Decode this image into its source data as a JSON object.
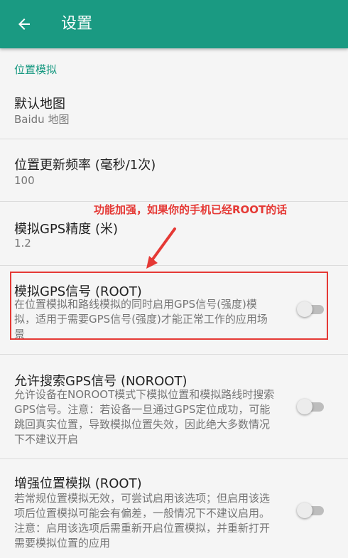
{
  "app_bar": {
    "title": "设置",
    "background": "#1a9a82",
    "back_icon": "arrow-left-icon"
  },
  "section": {
    "header": "位置模拟"
  },
  "settings": [
    {
      "title": "默认地图",
      "summary": "Baidu 地图"
    },
    {
      "title": "位置更新频率 (毫秒/1次)",
      "summary": "100"
    },
    {
      "title": "模拟GPS精度 (米)",
      "summary": "1.2"
    },
    {
      "title": "模拟GPS信号 (ROOT)",
      "summary": "在位置模拟和路线模拟的同时启用GPS信号(强度)模拟，适用于需要GPS信号(强度)才能正常工作的应用场景",
      "switch_on": false
    },
    {
      "title": "允许搜索GPS信号 (NOROOT)",
      "summary": "允许设备在NOROOT模式下模拟位置和模拟路线时搜索GPS信号。注意：若设备一旦通过GPS定位成功，可能跳回真实位置，导致模拟位置失效，因此绝大多数情况下不建议开启",
      "switch_on": false
    },
    {
      "title": "增强位置模拟 (ROOT)",
      "summary": "若常规位置模拟无效，可尝试启用该选项；但启用该选项后位置模拟可能会有偏差，一般情况下不建议启用。注意：启用该选项后需重新开启位置模拟，并重新打开需要模拟位置的应用",
      "switch_on": false
    }
  ],
  "annotation": {
    "text": "功能加强，如果你的手机已经ROOT的话",
    "color": "#e53935"
  }
}
